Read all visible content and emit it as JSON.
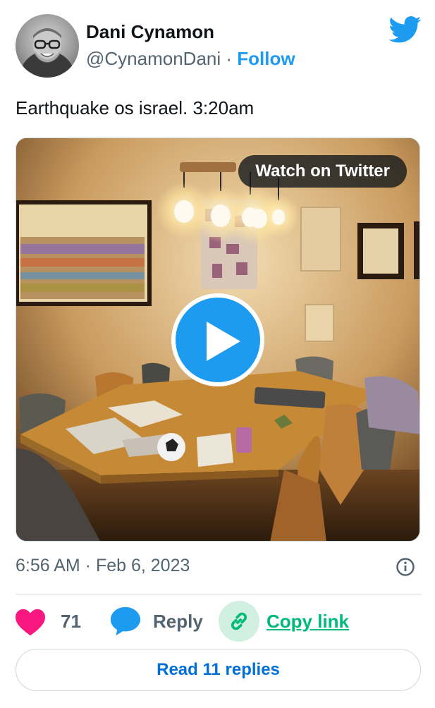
{
  "author": {
    "name": "Dani Cynamon",
    "handle": "@CynamonDani",
    "separator": "·",
    "follow_label": "Follow"
  },
  "tweet": {
    "text": "Earthquake os israel. 3:20am"
  },
  "media": {
    "watch_label": "Watch on Twitter"
  },
  "meta": {
    "timestamp": "6:56 AM · Feb 6, 2023"
  },
  "actions": {
    "like_count": "71",
    "reply_label": "Reply",
    "copy_label": "Copy link"
  },
  "footer": {
    "read_replies_label": "Read 11 replies"
  },
  "colors": {
    "accent": "#1d9bf0",
    "like": "#f91880",
    "copy": "#00ba7c",
    "muted": "#536471"
  },
  "icons": [
    "twitter-bird-icon",
    "play-icon",
    "heart-icon",
    "reply-bubble-icon",
    "link-icon",
    "info-icon"
  ]
}
